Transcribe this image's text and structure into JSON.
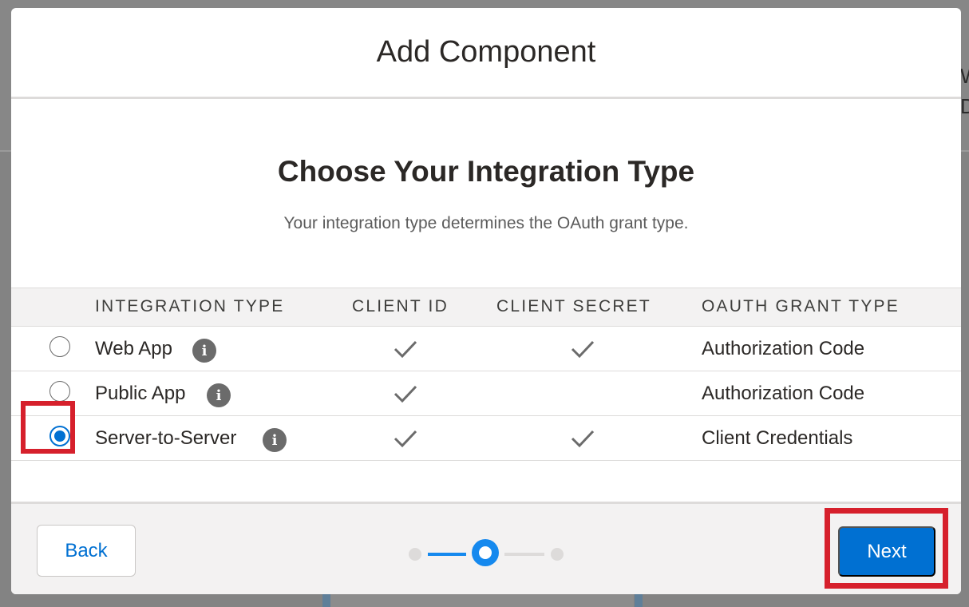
{
  "modal": {
    "title": "Add Component"
  },
  "section": {
    "title": "Choose Your Integration Type",
    "subtitle": "Your integration type determines the OAuth grant type."
  },
  "table": {
    "columns": [
      "INTEGRATION TYPE",
      "CLIENT ID",
      "CLIENT SECRET",
      "OAUTH GRANT TYPE"
    ],
    "rows": [
      {
        "name": "Web App",
        "client_id": true,
        "client_secret": true,
        "grant_type": "Authorization Code",
        "selected": false
      },
      {
        "name": "Public App",
        "client_id": true,
        "client_secret": false,
        "grant_type": "Authorization Code",
        "selected": false
      },
      {
        "name": "Server-to-Server",
        "client_id": true,
        "client_secret": true,
        "grant_type": "Client Credentials",
        "selected": true
      }
    ]
  },
  "footer": {
    "back_label": "Back",
    "next_label": "Next",
    "steps_total": 3,
    "current_step": 2
  },
  "background": {
    "partial_text_1": "W",
    "partial_text_2": "D"
  },
  "colors": {
    "accent": "#0070d2",
    "highlight": "#d6202c",
    "step_active": "#1589ee"
  },
  "icons": {
    "info": "info-icon",
    "check": "checkmark-icon"
  }
}
